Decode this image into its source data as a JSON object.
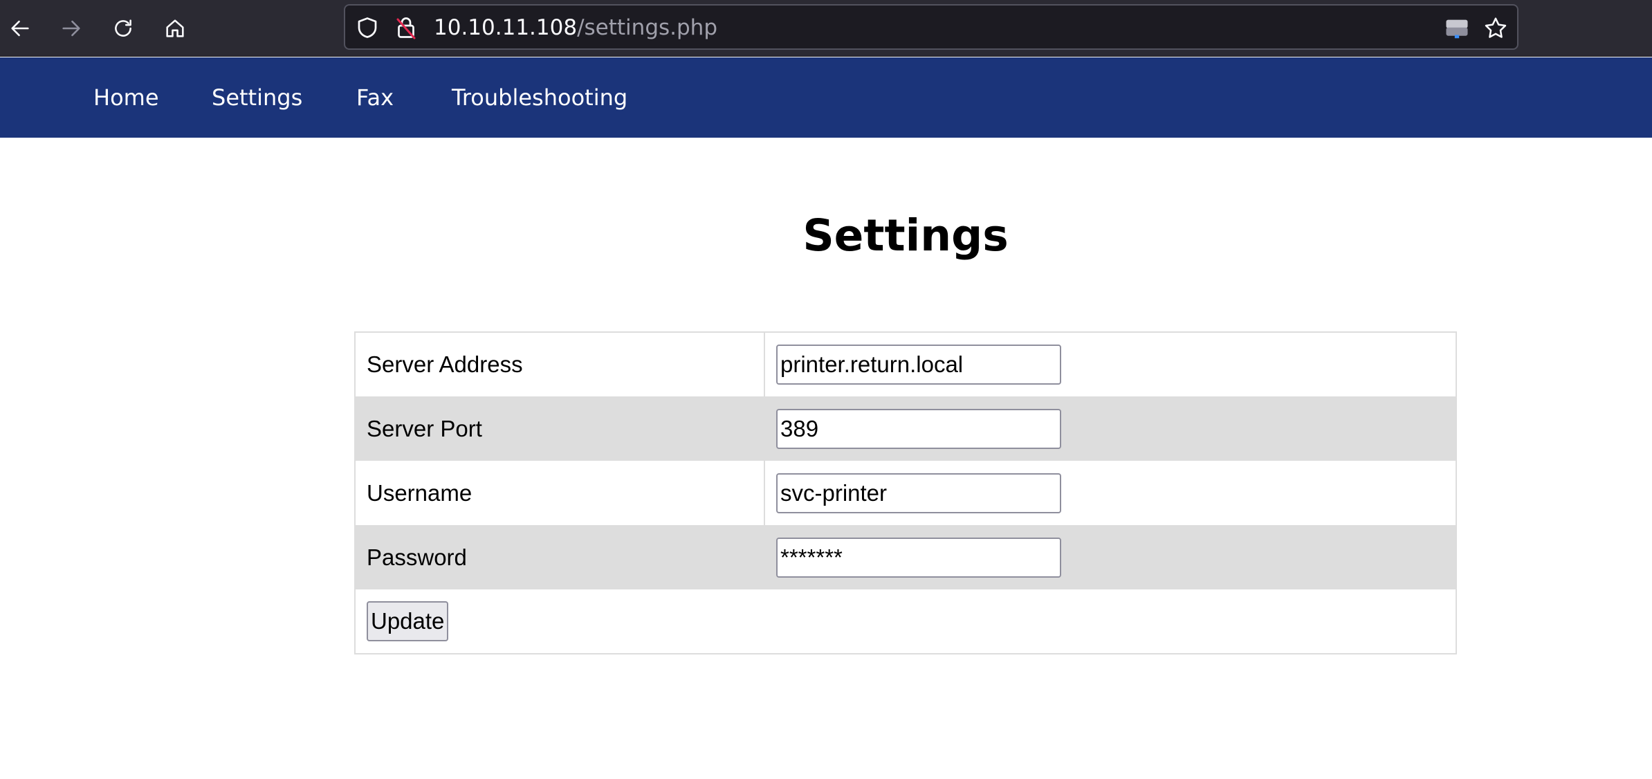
{
  "browser": {
    "url_host": "10.10.11.108",
    "url_path": "/settings.php",
    "icons": [
      "back-arrow-icon",
      "forward-arrow-icon",
      "reload-icon",
      "home-icon",
      "shield-icon",
      "insecure-lock-icon",
      "drive-icon",
      "bookmark-star-icon"
    ]
  },
  "nav": {
    "items": [
      {
        "label": "Home"
      },
      {
        "label": "Settings"
      },
      {
        "label": "Fax"
      },
      {
        "label": "Troubleshooting"
      }
    ]
  },
  "page": {
    "title": "Settings"
  },
  "form": {
    "rows": [
      {
        "label": "Server Address",
        "value": "printer.return.local"
      },
      {
        "label": "Server Port",
        "value": "389"
      },
      {
        "label": "Username",
        "value": "svc-printer"
      },
      {
        "label": "Password",
        "value": "*******"
      }
    ],
    "submit_label": "Update"
  },
  "colors": {
    "nav_bg": "#1b347a",
    "row_alt_bg": "#dddddd",
    "browser_bg": "#2b2a33",
    "insecure_lock": "#e22850"
  }
}
